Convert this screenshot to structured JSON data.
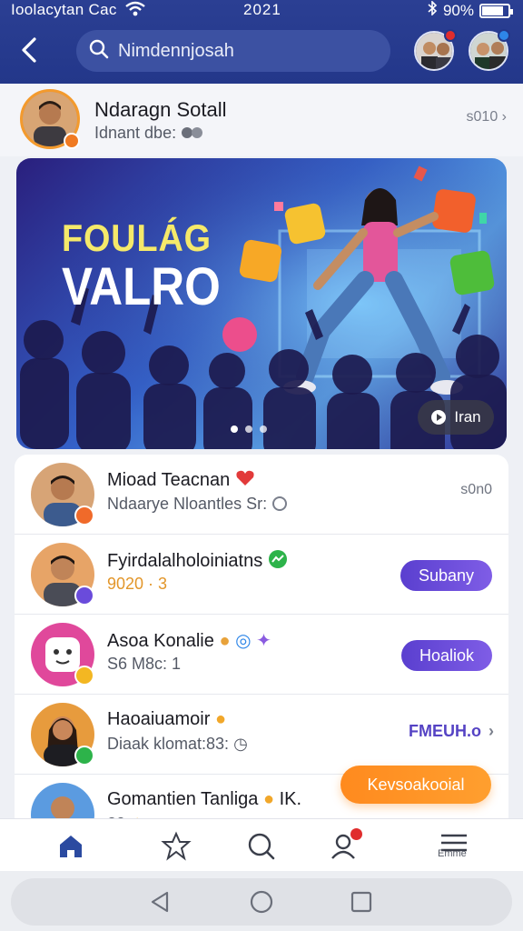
{
  "status": {
    "carrier": "Ioolacytan Cac",
    "clock": "2021",
    "battery": "90%",
    "battery_level": 0.9
  },
  "header": {
    "search_placeholder": "Nimdennjosah"
  },
  "profile": {
    "name": "Ndaragn Sotall",
    "sub": "Idnant dbe:",
    "right": "s010"
  },
  "banner": {
    "headline_1": "FOULÁG",
    "headline_2": "VALRO",
    "play_label": "Iran",
    "active_slide": 1,
    "slides": 3
  },
  "list": [
    {
      "name": "Mioad Teacnan",
      "sub": "Ndaarye Nloantles Sr:",
      "right_text": "s0n0"
    },
    {
      "name": "Fyirdalalholoiniatns",
      "sub": "9020 · 3",
      "button": "Subany"
    },
    {
      "name": "Asoa Konalie",
      "sub": "S6 M8c: 1",
      "button": "Hoaliok"
    },
    {
      "name": "Haoaiuamoir",
      "sub": "Diaak klomat:83:",
      "link": "FMEUH.o"
    },
    {
      "name": "Gomantien Tanliga",
      "suffix": "IK.",
      "sub": "20"
    }
  ],
  "fab_label": "Kevsoakooial",
  "tabbar": {
    "last_label": "Emme"
  },
  "colors": {
    "header": "#23378a",
    "accent_orange": "#ff8a1e",
    "accent_purple": "#6a4bdb"
  }
}
